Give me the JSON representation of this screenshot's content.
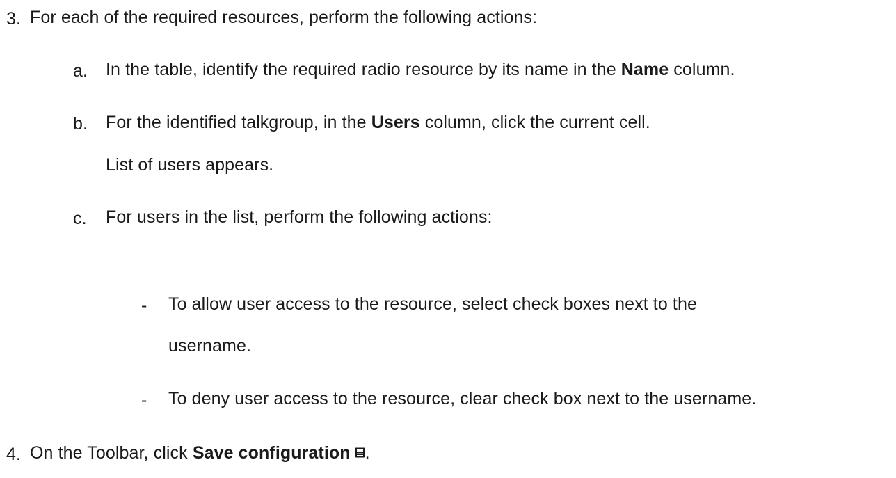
{
  "steps": {
    "step3": {
      "number": "3.",
      "text": "For each of the required resources, perform the following actions:",
      "substeps": {
        "a": {
          "marker": "a.",
          "before": "In the table, identify the required radio resource by its name in the ",
          "bold": "Name",
          "after": " column."
        },
        "b": {
          "marker": "b.",
          "before": "For the identified talkgroup, in the ",
          "bold": "Users",
          "after": " column, click the current cell.",
          "result": "List of users appears."
        },
        "c": {
          "marker": "c.",
          "text": "For users in the list, perform the following actions:",
          "bullets": [
            {
              "marker": "-",
              "line1": "To allow user access to the resource, select check boxes next to the",
              "line2": "username."
            },
            {
              "marker": "-",
              "line1": "To deny user access to the resource, clear check box next to the username."
            }
          ]
        }
      }
    },
    "step4": {
      "number": "4.",
      "before": "On the Toolbar, click ",
      "bold": "Save configuration",
      "icon": "save-icon",
      "after": "."
    }
  }
}
